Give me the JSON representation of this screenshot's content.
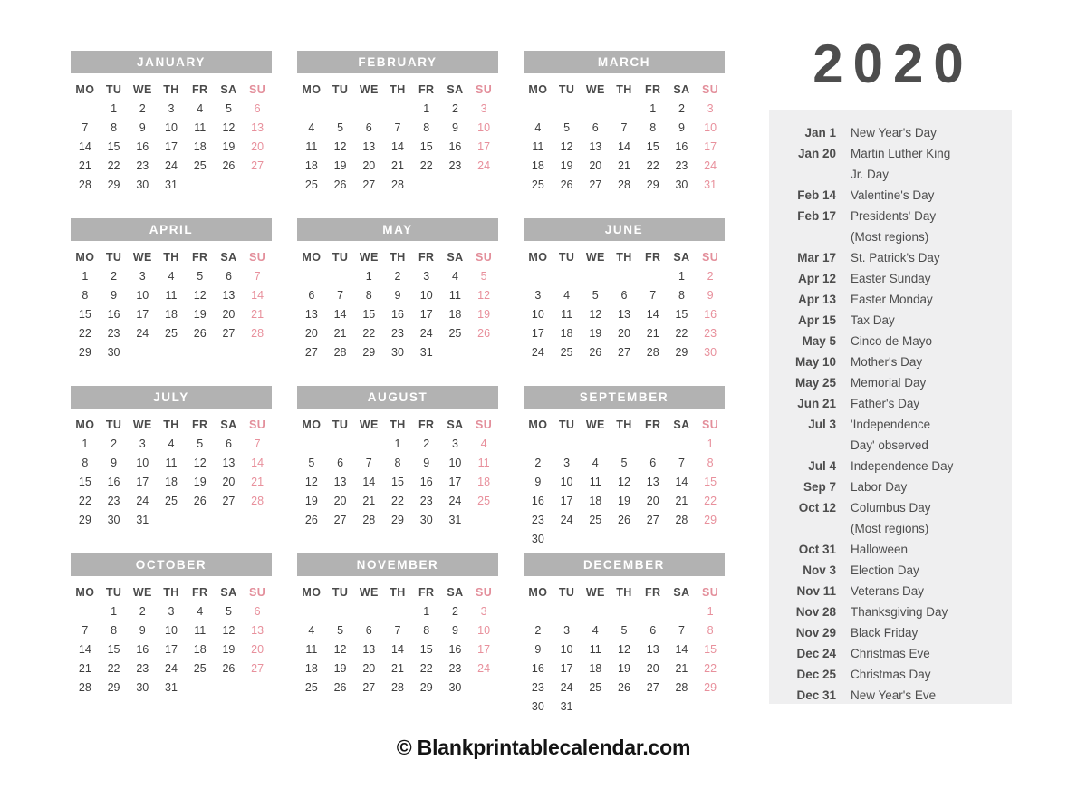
{
  "year_title": "2020",
  "footer": {
    "credit": "© Blankprintablecalendar.com"
  },
  "colors": {
    "month_header_bg": "#b2b2b2",
    "month_header_text": "#ffffff",
    "weekday_text": "#4a4a4a",
    "sunday_text": "#e8909c",
    "day_text": "#3d3d3d",
    "holiday_panel_bg": "#efeff0",
    "holiday_text": "#4d4d4d",
    "year_text": "#4d4d4d",
    "page_bg": "#ffffff"
  },
  "weekday_headers": [
    "MO",
    "TU",
    "WE",
    "TH",
    "FR",
    "SA",
    "SU"
  ],
  "months": [
    {
      "name": "JANUARY",
      "weeks": [
        [
          "",
          "1",
          "2",
          "3",
          "4",
          "5",
          "6"
        ],
        [
          "7",
          "8",
          "9",
          "10",
          "11",
          "12",
          "13"
        ],
        [
          "14",
          "15",
          "16",
          "17",
          "18",
          "19",
          "20"
        ],
        [
          "21",
          "22",
          "23",
          "24",
          "25",
          "26",
          "27"
        ],
        [
          "28",
          "29",
          "30",
          "31",
          "",
          "",
          ""
        ]
      ]
    },
    {
      "name": "FEBRUARY",
      "weeks": [
        [
          "",
          "",
          "",
          "",
          "1",
          "2",
          "3"
        ],
        [
          "4",
          "5",
          "6",
          "7",
          "8",
          "9",
          "10"
        ],
        [
          "11",
          "12",
          "13",
          "14",
          "15",
          "16",
          "17"
        ],
        [
          "18",
          "19",
          "20",
          "21",
          "22",
          "23",
          "24"
        ],
        [
          "25",
          "26",
          "27",
          "28",
          "",
          "",
          ""
        ]
      ]
    },
    {
      "name": "MARCH",
      "weeks": [
        [
          "",
          "",
          "",
          "",
          "1",
          "2",
          "3"
        ],
        [
          "4",
          "5",
          "6",
          "7",
          "8",
          "9",
          "10"
        ],
        [
          "11",
          "12",
          "13",
          "14",
          "15",
          "16",
          "17"
        ],
        [
          "18",
          "19",
          "20",
          "21",
          "22",
          "23",
          "24"
        ],
        [
          "25",
          "26",
          "27",
          "28",
          "29",
          "30",
          "31"
        ]
      ]
    },
    {
      "name": "APRIL",
      "weeks": [
        [
          "1",
          "2",
          "3",
          "4",
          "5",
          "6",
          "7"
        ],
        [
          "8",
          "9",
          "10",
          "11",
          "12",
          "13",
          "14"
        ],
        [
          "15",
          "16",
          "17",
          "18",
          "19",
          "20",
          "21"
        ],
        [
          "22",
          "23",
          "24",
          "25",
          "26",
          "27",
          "28"
        ],
        [
          "29",
          "30",
          "",
          "",
          "",
          "",
          ""
        ]
      ]
    },
    {
      "name": "MAY",
      "weeks": [
        [
          "",
          "",
          "1",
          "2",
          "3",
          "4",
          "5"
        ],
        [
          "6",
          "7",
          "8",
          "9",
          "10",
          "11",
          "12"
        ],
        [
          "13",
          "14",
          "15",
          "16",
          "17",
          "18",
          "19"
        ],
        [
          "20",
          "21",
          "22",
          "23",
          "24",
          "25",
          "26"
        ],
        [
          "27",
          "28",
          "29",
          "30",
          "31",
          "",
          ""
        ]
      ]
    },
    {
      "name": "JUNE",
      "weeks": [
        [
          "",
          "",
          "",
          "",
          "",
          "1",
          "2"
        ],
        [
          "3",
          "4",
          "5",
          "6",
          "7",
          "8",
          "9"
        ],
        [
          "10",
          "11",
          "12",
          "13",
          "14",
          "15",
          "16"
        ],
        [
          "17",
          "18",
          "19",
          "20",
          "21",
          "22",
          "23"
        ],
        [
          "24",
          "25",
          "26",
          "27",
          "28",
          "29",
          "30"
        ]
      ]
    },
    {
      "name": "JULY",
      "weeks": [
        [
          "1",
          "2",
          "3",
          "4",
          "5",
          "6",
          "7"
        ],
        [
          "8",
          "9",
          "10",
          "11",
          "12",
          "13",
          "14"
        ],
        [
          "15",
          "16",
          "17",
          "18",
          "19",
          "20",
          "21"
        ],
        [
          "22",
          "23",
          "24",
          "25",
          "26",
          "27",
          "28"
        ],
        [
          "29",
          "30",
          "31",
          "",
          "",
          "",
          ""
        ]
      ]
    },
    {
      "name": "AUGUST",
      "weeks": [
        [
          "",
          "",
          "",
          "1",
          "2",
          "3",
          "4"
        ],
        [
          "5",
          "6",
          "7",
          "8",
          "9",
          "10",
          "11"
        ],
        [
          "12",
          "13",
          "14",
          "15",
          "16",
          "17",
          "18"
        ],
        [
          "19",
          "20",
          "21",
          "22",
          "23",
          "24",
          "25"
        ],
        [
          "26",
          "27",
          "28",
          "29",
          "30",
          "31",
          ""
        ]
      ]
    },
    {
      "name": "SEPTEMBER",
      "weeks": [
        [
          "",
          "",
          "",
          "",
          "",
          "",
          "1"
        ],
        [
          "2",
          "3",
          "4",
          "5",
          "6",
          "7",
          "8"
        ],
        [
          "9",
          "10",
          "11",
          "12",
          "13",
          "14",
          "15"
        ],
        [
          "16",
          "17",
          "18",
          "19",
          "20",
          "21",
          "22"
        ],
        [
          "23",
          "24",
          "25",
          "26",
          "27",
          "28",
          "29"
        ],
        [
          "30",
          "",
          "",
          "",
          "",
          "",
          ""
        ]
      ]
    },
    {
      "name": "OCTOBER",
      "weeks": [
        [
          "",
          "1",
          "2",
          "3",
          "4",
          "5",
          "6"
        ],
        [
          "7",
          "8",
          "9",
          "10",
          "11",
          "12",
          "13"
        ],
        [
          "14",
          "15",
          "16",
          "17",
          "18",
          "19",
          "20"
        ],
        [
          "21",
          "22",
          "23",
          "24",
          "25",
          "26",
          "27"
        ],
        [
          "28",
          "29",
          "30",
          "31",
          "",
          "",
          ""
        ]
      ]
    },
    {
      "name": "NOVEMBER",
      "weeks": [
        [
          "",
          "",
          "",
          "",
          "1",
          "2",
          "3"
        ],
        [
          "4",
          "5",
          "6",
          "7",
          "8",
          "9",
          "10"
        ],
        [
          "11",
          "12",
          "13",
          "14",
          "15",
          "16",
          "17"
        ],
        [
          "18",
          "19",
          "20",
          "21",
          "22",
          "23",
          "24"
        ],
        [
          "25",
          "26",
          "27",
          "28",
          "29",
          "30",
          ""
        ]
      ]
    },
    {
      "name": "DECEMBER",
      "weeks": [
        [
          "",
          "",
          "",
          "",
          "",
          "",
          "1"
        ],
        [
          "2",
          "3",
          "4",
          "5",
          "6",
          "7",
          "8"
        ],
        [
          "9",
          "10",
          "11",
          "12",
          "13",
          "14",
          "15"
        ],
        [
          "16",
          "17",
          "18",
          "19",
          "20",
          "21",
          "22"
        ],
        [
          "23",
          "24",
          "25",
          "26",
          "27",
          "28",
          "29"
        ],
        [
          "30",
          "31",
          "",
          "",
          "",
          "",
          ""
        ]
      ]
    }
  ],
  "holidays": [
    {
      "date": "Jan 1",
      "name": "New Year's Day",
      "name_cont": ""
    },
    {
      "date": "Jan 20",
      "name": "Martin Luther King",
      "name_cont": "Jr. Day"
    },
    {
      "date": "Feb 14",
      "name": "Valentine's Day",
      "name_cont": ""
    },
    {
      "date": "Feb 17",
      "name": "Presidents' Day",
      "name_cont": "(Most regions)"
    },
    {
      "date": "Mar 17",
      "name": "St. Patrick's Day",
      "name_cont": ""
    },
    {
      "date": "Apr 12",
      "name": "Easter Sunday",
      "name_cont": ""
    },
    {
      "date": "Apr 13",
      "name": "Easter Monday",
      "name_cont": ""
    },
    {
      "date": "Apr 15",
      "name": "Tax Day",
      "name_cont": ""
    },
    {
      "date": "May 5",
      "name": "Cinco de Mayo",
      "name_cont": ""
    },
    {
      "date": "May 10",
      "name": "Mother's Day",
      "name_cont": ""
    },
    {
      "date": "May 25",
      "name": "Memorial Day",
      "name_cont": ""
    },
    {
      "date": "Jun 21",
      "name": "Father's Day",
      "name_cont": ""
    },
    {
      "date": "Jul 3",
      "name": "'Independence",
      "name_cont": "Day' observed"
    },
    {
      "date": "Jul 4",
      "name": "Independence Day",
      "name_cont": ""
    },
    {
      "date": "Sep 7",
      "name": "Labor Day",
      "name_cont": ""
    },
    {
      "date": "Oct 12",
      "name": "Columbus Day",
      "name_cont": "(Most regions)"
    },
    {
      "date": "Oct 31",
      "name": "Halloween",
      "name_cont": ""
    },
    {
      "date": "Nov 3",
      "name": "Election Day",
      "name_cont": ""
    },
    {
      "date": "Nov 11",
      "name": "Veterans Day",
      "name_cont": ""
    },
    {
      "date": "Nov 28",
      "name": "Thanksgiving Day",
      "name_cont": ""
    },
    {
      "date": "Nov 29",
      "name": "Black Friday",
      "name_cont": ""
    },
    {
      "date": "Dec 24",
      "name": "Christmas Eve",
      "name_cont": ""
    },
    {
      "date": "Dec 25",
      "name": "Christmas Day",
      "name_cont": ""
    },
    {
      "date": "Dec 31",
      "name": "New Year's Eve",
      "name_cont": ""
    }
  ]
}
